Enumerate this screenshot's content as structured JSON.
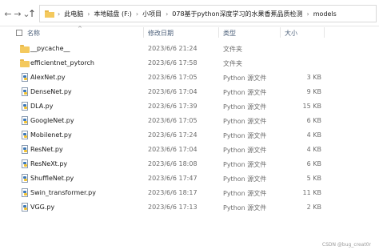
{
  "nav": {
    "back_icon": "←",
    "forward_icon": "→",
    "recent_icon": "⌄",
    "up_icon": "↑"
  },
  "breadcrumbs": [
    {
      "label": "此电脑"
    },
    {
      "label": "本地磁盘 (F:)"
    },
    {
      "label": "小项目"
    },
    {
      "label": "078基于python深度学习的水果香蕉品质检测"
    },
    {
      "label": "models"
    }
  ],
  "breadcrumb_separator": "›",
  "columns": {
    "name": "名称",
    "date": "修改日期",
    "type": "类型",
    "size": "大小"
  },
  "files": [
    {
      "name": "__pycache__",
      "date": "2023/6/6 21:24",
      "type": "文件夹",
      "size": "",
      "kind": "folder"
    },
    {
      "name": "efficientnet_pytorch",
      "date": "2023/6/6 17:58",
      "type": "文件夹",
      "size": "",
      "kind": "folder"
    },
    {
      "name": "AlexNet.py",
      "date": "2023/6/6 17:05",
      "type": "Python 源文件",
      "size": "3 KB",
      "kind": "py"
    },
    {
      "name": "DenseNet.py",
      "date": "2023/6/6 17:04",
      "type": "Python 源文件",
      "size": "9 KB",
      "kind": "py"
    },
    {
      "name": "DLA.py",
      "date": "2023/6/6 17:39",
      "type": "Python 源文件",
      "size": "15 KB",
      "kind": "py"
    },
    {
      "name": "GoogleNet.py",
      "date": "2023/6/6 17:05",
      "type": "Python 源文件",
      "size": "6 KB",
      "kind": "py"
    },
    {
      "name": "Mobilenet.py",
      "date": "2023/6/6 17:24",
      "type": "Python 源文件",
      "size": "4 KB",
      "kind": "py"
    },
    {
      "name": "ResNet.py",
      "date": "2023/6/6 17:04",
      "type": "Python 源文件",
      "size": "4 KB",
      "kind": "py"
    },
    {
      "name": "ResNeXt.py",
      "date": "2023/6/6 18:08",
      "type": "Python 源文件",
      "size": "6 KB",
      "kind": "py"
    },
    {
      "name": "ShuffleNet.py",
      "date": "2023/6/6 17:47",
      "type": "Python 源文件",
      "size": "5 KB",
      "kind": "py"
    },
    {
      "name": "Swin_transformer.py",
      "date": "2023/6/6 18:17",
      "type": "Python 源文件",
      "size": "11 KB",
      "kind": "py"
    },
    {
      "name": "VGG.py",
      "date": "2023/6/6 17:13",
      "type": "Python 源文件",
      "size": "2 KB",
      "kind": "py"
    }
  ],
  "watermark": "CSDN @bug_creat0r"
}
